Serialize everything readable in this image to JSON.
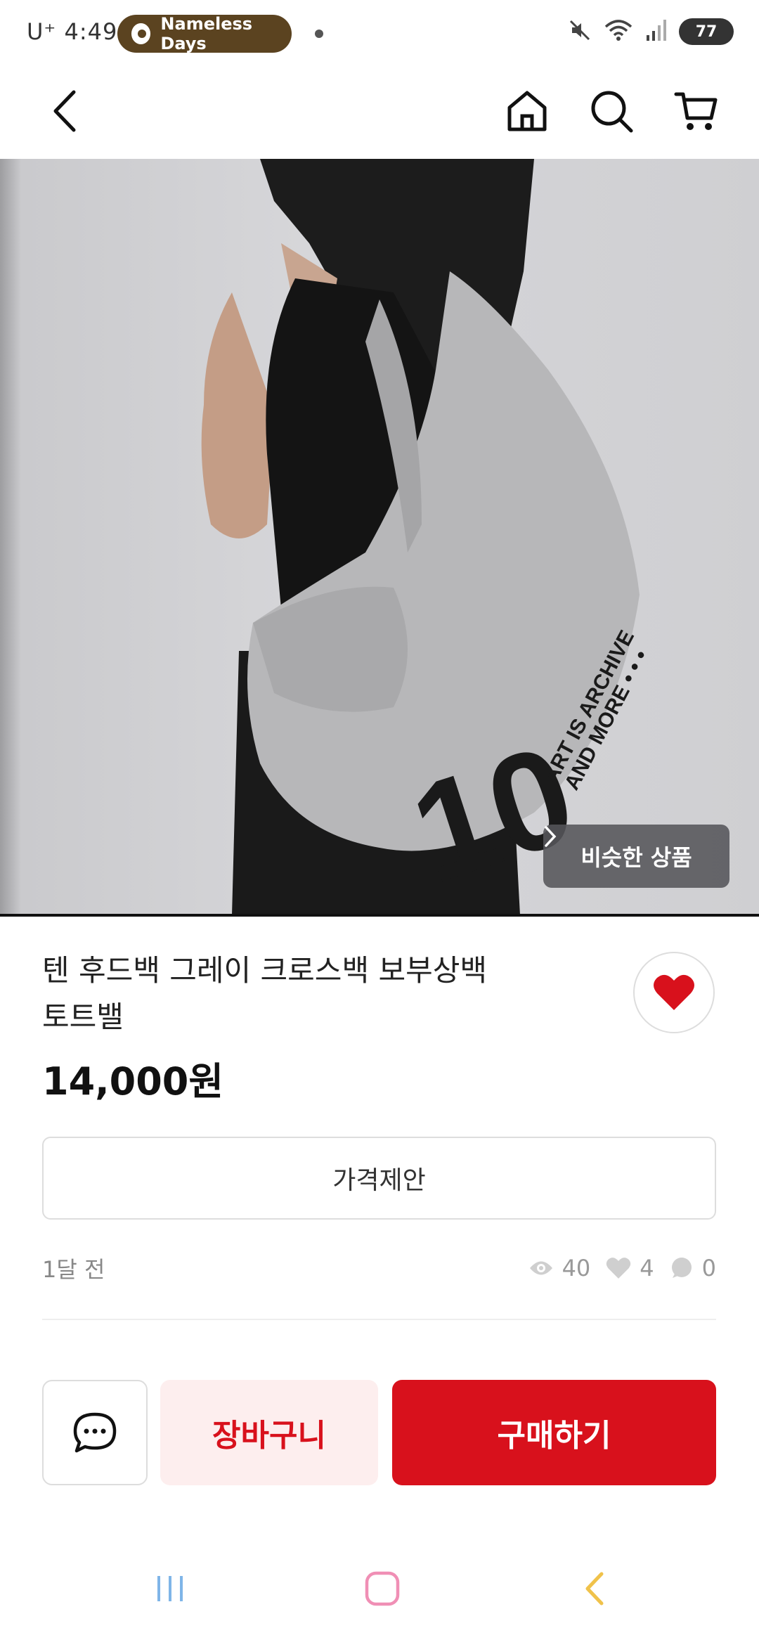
{
  "status_bar": {
    "carrier_time": "U⁺ 4:49",
    "app_pill_label": "Nameless Days",
    "battery": "77"
  },
  "header": {
    "back_icon": "chevron-left-icon",
    "home_icon": "home-icon",
    "search_icon": "search-icon",
    "cart_icon": "cart-icon"
  },
  "product": {
    "similar_button_label": "비슷한 상품",
    "title_line1": "텐 후드백 그레이 크로스백 보부상백",
    "title_line2": "토트밸",
    "price": "14,000원",
    "liked": true,
    "offer_button_label": "가격제안",
    "posted": "1달 전",
    "views": "40",
    "likes": "4",
    "chats": "0",
    "bag_print_number": "10",
    "bag_print_text_1": "ART IS ARCHIVE",
    "bag_print_text_2": "AND MORE • • •"
  },
  "bottom_bar": {
    "chat_icon": "chat-bubble-icon",
    "cart_button_label": "장바구니",
    "buy_button_label": "구매하기"
  },
  "colors": {
    "accent_red": "#d8111c",
    "cart_bg": "#fdeeee",
    "pill_brown": "#5b4320",
    "similar_bg": "#55555a"
  }
}
